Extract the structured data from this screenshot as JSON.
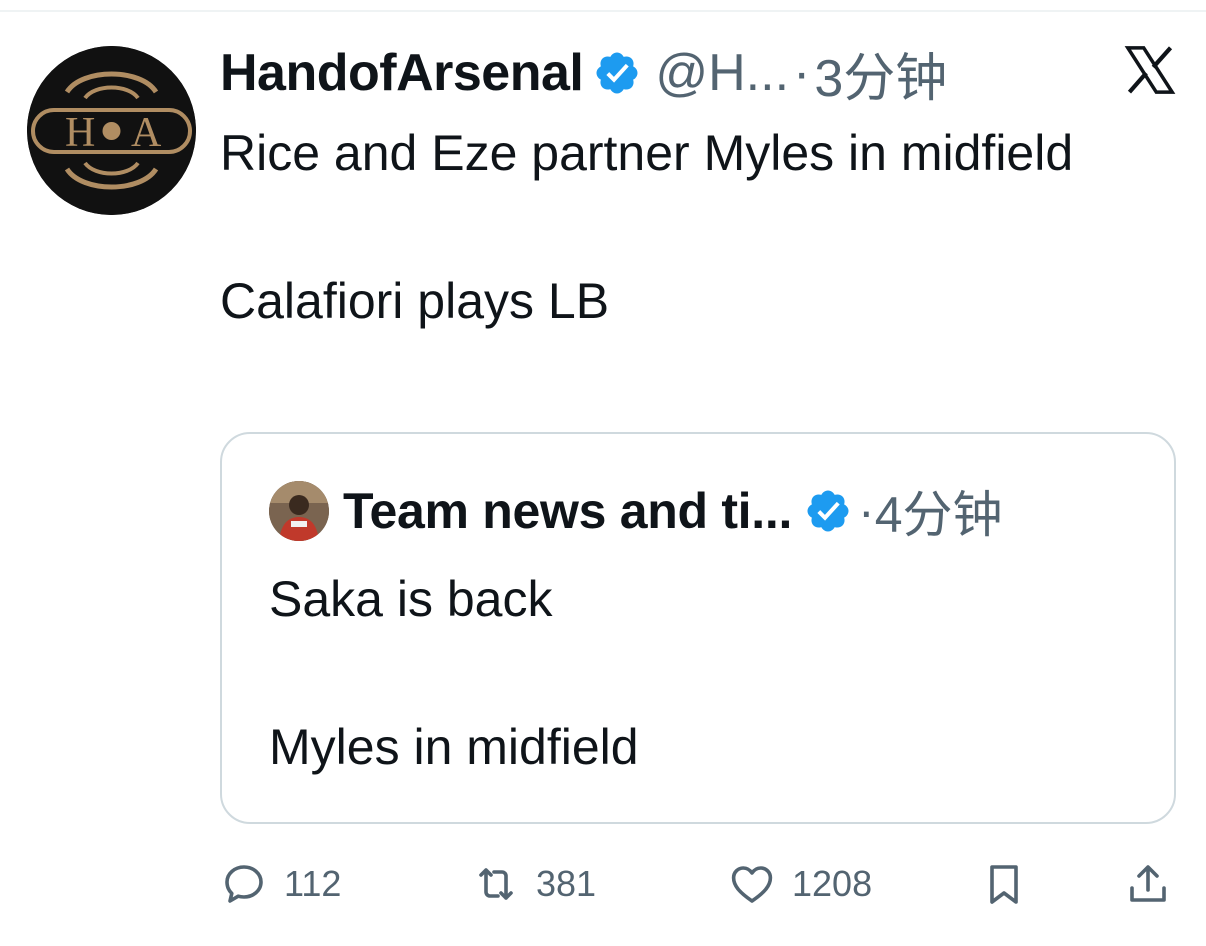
{
  "tweet": {
    "display_name": "HandofArsenal",
    "handle": "@H...",
    "separator": "·",
    "time": "3分钟",
    "paragraphs": [
      "Rice and Eze partner Myles in midfield",
      "Calafiori plays LB"
    ],
    "avatar_letters": {
      "left": "H",
      "right": "A"
    },
    "verified_icon": "verified-badge-icon",
    "platform_icon": "x-logo-icon"
  },
  "quoted_tweet": {
    "display_name": "Team news and ti...",
    "separator": "·",
    "time": "4分钟",
    "paragraphs": [
      "Saka is back",
      "Myles in midfield"
    ]
  },
  "actions": {
    "replies": "112",
    "retweets": "381",
    "likes": "1208",
    "icons": [
      "reply-icon",
      "retweet-icon",
      "like-icon",
      "bookmark-icon",
      "share-icon"
    ]
  },
  "colors": {
    "text": "#0f1419",
    "secondary": "#536471",
    "verified": "#1d9bf0",
    "border": "#cfd9de",
    "avatar_gold": "#b08d62"
  }
}
